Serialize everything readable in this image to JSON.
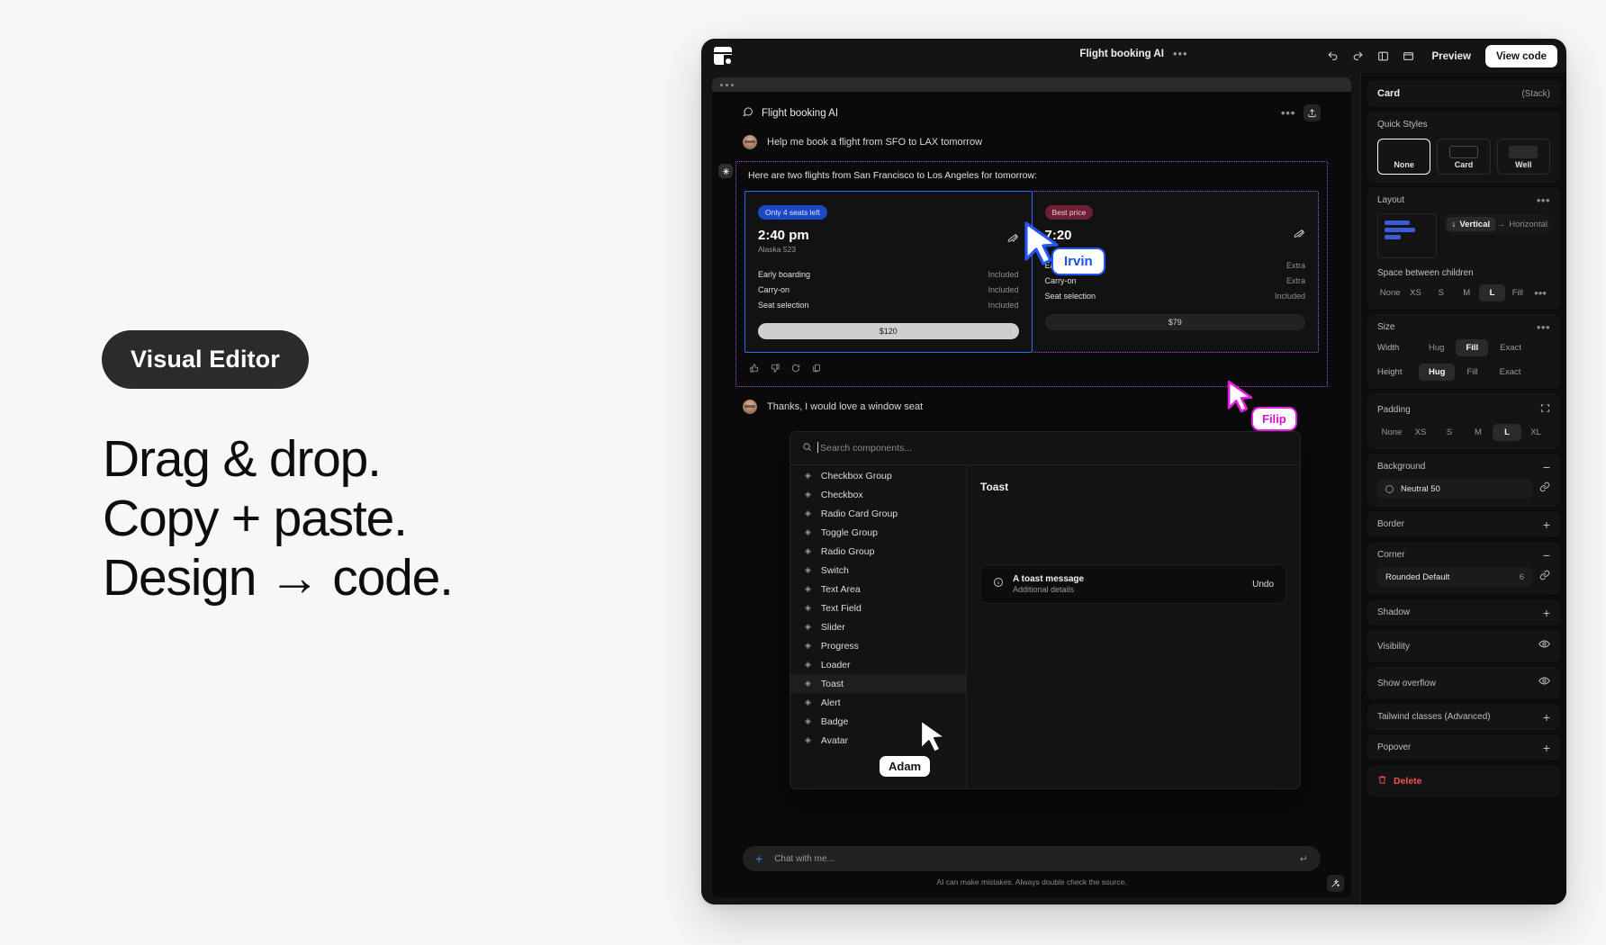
{
  "marketing": {
    "pill": "Visual Editor",
    "headline_lines": [
      "Drag & drop.",
      "Copy + paste.",
      "Design → code."
    ]
  },
  "window": {
    "title": "Flight booking AI",
    "menu_dots": "•••",
    "toolbar": {
      "undo": "undo-icon",
      "redo": "redo-icon",
      "panel": "panel-icon",
      "frame": "frame-icon",
      "preview_label": "Preview",
      "view_code_label": "View code"
    }
  },
  "chat": {
    "header_title": "Flight booking AI",
    "messages": [
      {
        "role": "user",
        "text": "Help me book a flight from SFO to LAX tomorrow"
      },
      {
        "role": "assistant",
        "text": "Here are two flights from San Francisco to Los Angeles for tomorrow:"
      },
      {
        "role": "user",
        "text": "Thanks, I would love a window seat"
      }
    ],
    "reactions": [
      "thumbs-up-icon",
      "thumbs-down-icon",
      "refresh-icon",
      "copy-icon"
    ],
    "composer_placeholder": "Chat with me...",
    "disclaimer": "AI can make mistakes. Always double check the source."
  },
  "flights": [
    {
      "badge": "Only 4 seats left",
      "badge_tone": "blue",
      "time": "2:40 pm",
      "carrier": "Alaska 523",
      "features": [
        {
          "label": "Early boarding",
          "value": "Included"
        },
        {
          "label": "Carry-on",
          "value": "Included"
        },
        {
          "label": "Seat selection",
          "value": "Included"
        }
      ],
      "price": "$120",
      "selected": true
    },
    {
      "badge": "Best price",
      "badge_tone": "wine",
      "time": "",
      "carrier": "",
      "features": [
        {
          "label": "Early boarding",
          "value": "Extra"
        },
        {
          "label": "Carry-on",
          "value": "Extra"
        },
        {
          "label": "Seat selection",
          "value": "Included"
        }
      ],
      "price": "$79",
      "selected": false
    }
  ],
  "palette": {
    "search_placeholder": "Search components...",
    "items": [
      "Checkbox Group",
      "Checkbox",
      "Radio Card Group",
      "Toggle Group",
      "Radio Group",
      "Switch",
      "Text Area",
      "Text Field",
      "Slider",
      "Progress",
      "Loader",
      "Toast",
      "Alert",
      "Badge",
      "Avatar"
    ],
    "active_item": "Toast",
    "preview_title": "Toast",
    "toast": {
      "title": "A toast message",
      "subtitle": "Additional details",
      "action": "Undo",
      "icon": "info-icon"
    }
  },
  "inspector": {
    "selection_name": "Card",
    "selection_type": "(Stack)",
    "quick_styles": {
      "title": "Quick Styles",
      "options": [
        "None",
        "Card",
        "Well"
      ],
      "selected": "None"
    },
    "layout": {
      "title": "Layout",
      "direction_options": [
        "Vertical",
        "Horizontal"
      ],
      "direction_selected": "Vertical",
      "space_label": "Space between children",
      "space_options": [
        "None",
        "XS",
        "S",
        "M",
        "L",
        "Fill"
      ],
      "space_selected": "L"
    },
    "size": {
      "title": "Size",
      "width_label": "Width",
      "width_options": [
        "Hug",
        "Fill",
        "Exact"
      ],
      "width_selected": "Fill",
      "height_label": "Height",
      "height_options": [
        "Hug",
        "Fill",
        "Exact"
      ],
      "height_selected": "Hug"
    },
    "padding": {
      "title": "Padding",
      "options": [
        "None",
        "XS",
        "S",
        "M",
        "L",
        "XL"
      ],
      "selected": "L"
    },
    "background": {
      "title": "Background",
      "value": "Neutral 50"
    },
    "border": {
      "title": "Border"
    },
    "corner": {
      "title": "Corner",
      "value": "Rounded Default",
      "number": "6"
    },
    "shadow": {
      "title": "Shadow"
    },
    "visibility": {
      "title": "Visibility"
    },
    "overflow": {
      "title": "Show overflow"
    },
    "tailwind": {
      "title": "Tailwind classes (Advanced)"
    },
    "popover": {
      "title": "Popover"
    },
    "delete": {
      "title": "Delete"
    }
  },
  "cursors": [
    {
      "name": "Irvin",
      "color": "#2356f6"
    },
    {
      "name": "Filip",
      "color": "#e01ee0"
    },
    {
      "name": "Adam",
      "color": "#141414"
    }
  ]
}
